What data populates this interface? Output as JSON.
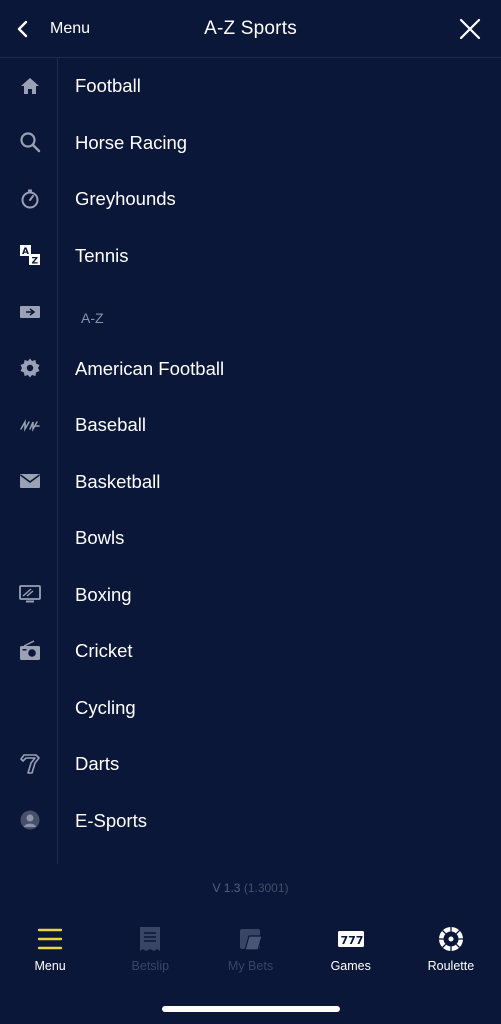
{
  "header": {
    "back_label": "Menu",
    "title": "A-Z Sports"
  },
  "rail_icons": [
    "home-icon",
    "search-icon",
    "stopwatch-icon",
    "az-icon",
    "ticket-icon",
    "gear-icon",
    "signature-icon",
    "envelope-icon",
    "monitor-icon",
    "radio-icon",
    "shirt-icon",
    "avatar-icon"
  ],
  "list": {
    "featured": [
      "Football",
      "Horse Racing",
      "Greyhounds",
      "Tennis"
    ],
    "section_label": "A-Z",
    "az": [
      "American Football",
      "Baseball",
      "Basketball",
      "Bowls",
      "Boxing",
      "Cricket",
      "Cycling",
      "Darts",
      "E-Sports"
    ]
  },
  "version": {
    "number": "V 1.3",
    "build": "(1.3001)"
  },
  "tabs": [
    {
      "label": "Menu",
      "icon": "hamburger-icon",
      "state": "selected"
    },
    {
      "label": "Betslip",
      "icon": "betslip-icon",
      "state": "disabled"
    },
    {
      "label": "My Bets",
      "icon": "mybets-icon",
      "state": "disabled"
    },
    {
      "label": "Games",
      "icon": "slots-icon",
      "state": "normal"
    },
    {
      "label": "Roulette",
      "icon": "roulette-icon",
      "state": "normal"
    }
  ],
  "colors": {
    "background": "#0b1738",
    "accent_yellow": "#e8d640",
    "muted_text": "#8a93ad",
    "icon_grey": "#9aa1b5"
  }
}
